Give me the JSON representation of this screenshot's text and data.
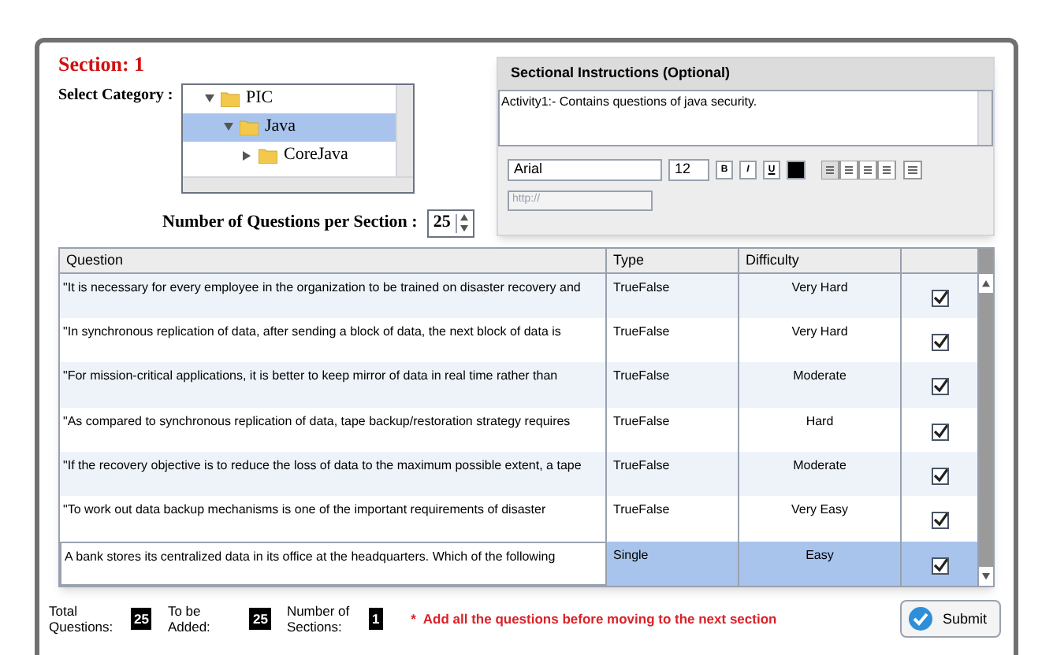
{
  "section_title": "Section: 1",
  "category": {
    "label": "Select Category :",
    "tree": [
      {
        "label": "PIC",
        "expanded": true,
        "selected": false,
        "children": [
          {
            "label": "Java",
            "expanded": true,
            "selected": true,
            "children": [
              {
                "label": "CoreJava",
                "expanded": false,
                "selected": false
              }
            ]
          }
        ]
      }
    ]
  },
  "questions_per_section": {
    "label": "Number of Questions per Section :",
    "value": "25"
  },
  "instructions": {
    "title": "Sectional Instructions (Optional)",
    "text": "Activity1:- Contains questions of java security.",
    "font": "Arial",
    "size": "12",
    "bold": "B",
    "italic": "I",
    "underline": "U",
    "link_placeholder": "http://"
  },
  "table": {
    "columns": [
      "Question",
      "Type",
      "Difficulty"
    ],
    "rows": [
      {
        "question": "\"It is necessary for every employee in the organization to be trained on disaster recovery and",
        "type": "TrueFalse",
        "difficulty": "Very Hard",
        "checked": true,
        "selected": false
      },
      {
        "question": "\"In synchronous replication of data, after sending a block of data, the next block of data is",
        "type": "TrueFalse",
        "difficulty": "Very Hard",
        "checked": true,
        "selected": false
      },
      {
        "question": "\"For mission-critical applications, it is better to keep mirror of data in real time rather than",
        "type": "TrueFalse",
        "difficulty": "Moderate",
        "checked": true,
        "selected": false
      },
      {
        "question": "\"As compared to synchronous replication of data, tape backup/restoration strategy requires",
        "type": "TrueFalse",
        "difficulty": "Hard",
        "checked": true,
        "selected": false
      },
      {
        "question": "\"If the recovery objective is to reduce the loss of data to the maximum possible extent, a tape",
        "type": "TrueFalse",
        "difficulty": "Moderate",
        "checked": true,
        "selected": false
      },
      {
        "question": "\"To work out data backup mechanisms is one of the important requirements of disaster",
        "type": "TrueFalse",
        "difficulty": "Very Easy",
        "checked": true,
        "selected": false
      },
      {
        "question": "A bank stores its centralized data in its office at the headquarters. Which of the following",
        "type": "Single",
        "difficulty": "Easy",
        "checked": true,
        "selected": true
      }
    ]
  },
  "footer": {
    "stats": [
      {
        "label": "Total Questions:",
        "value": "25"
      },
      {
        "label": "To be Added:",
        "value": "25"
      },
      {
        "label": "Number of Sections:",
        "value": "1"
      }
    ],
    "note": "*  Add all the questions before moving to the next section",
    "submit": "Submit"
  }
}
